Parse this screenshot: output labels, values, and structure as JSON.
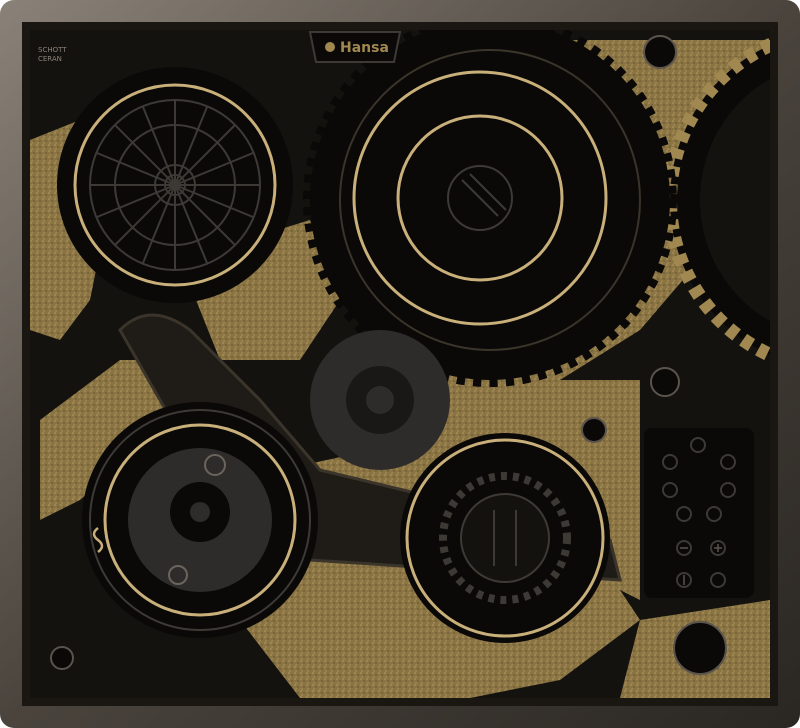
{
  "product": {
    "brand": "Hansa",
    "glass_logo_line1": "SCHOTT",
    "glass_logo_line2": "CERAN"
  },
  "cooking_zones": [
    {
      "name": "rear-left-zone"
    },
    {
      "name": "rear-right-zone"
    },
    {
      "name": "front-left-dual-zone"
    },
    {
      "name": "front-right-zone"
    }
  ],
  "control_panel": {
    "keys": [
      {
        "icon": "zone-selector-icon"
      },
      {
        "icon": "zone-selector-icon"
      },
      {
        "icon": "zone-selector-icon"
      },
      {
        "icon": "zone-selector-icon"
      },
      {
        "icon": "zone-selector-icon"
      },
      {
        "icon": "zone-selector-icon"
      },
      {
        "icon": "zone-selector-icon"
      },
      {
        "icon": "minus-icon"
      },
      {
        "icon": "plus-icon"
      },
      {
        "icon": "power-icon"
      },
      {
        "icon": "lock-icon"
      }
    ]
  },
  "colors": {
    "frame": "#5a5248",
    "glass": "#14120f",
    "gold": "#a08850",
    "zone_ring": "#c9b07a",
    "gear_dark": "#0a0908",
    "gear_gray": "#2e2c2a"
  }
}
